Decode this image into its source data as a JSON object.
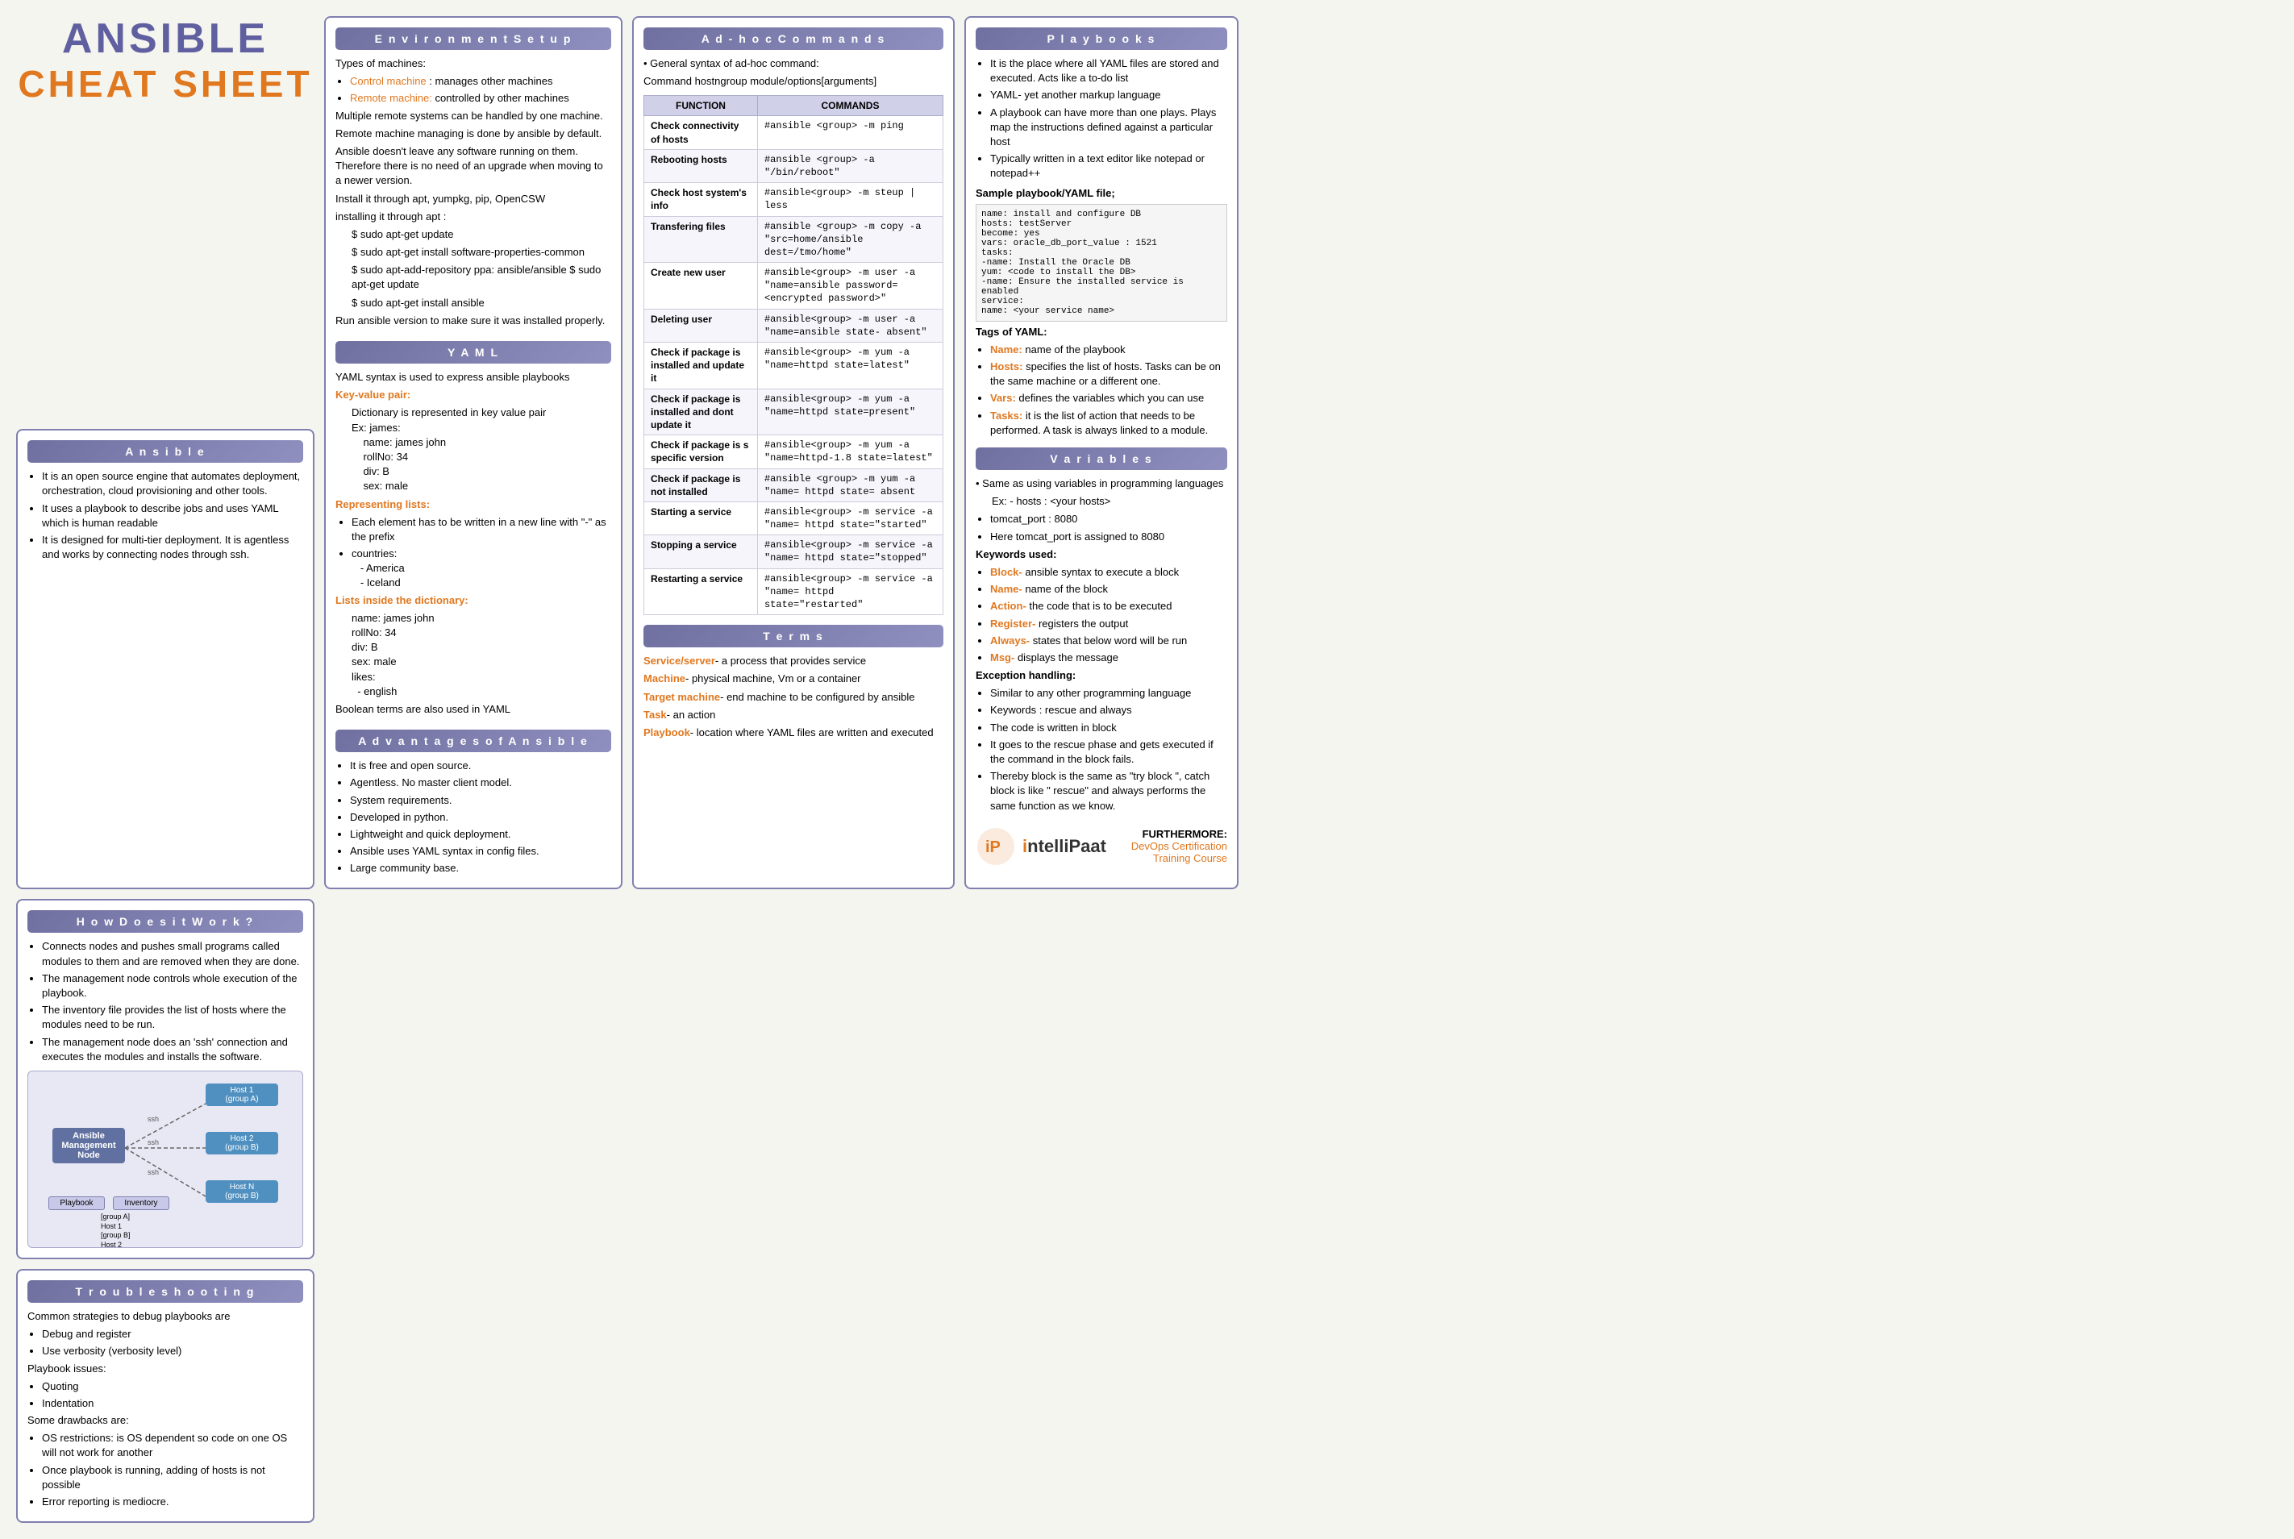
{
  "title": {
    "line1": "ANSIBLE",
    "line2": "CHEAT SHEET"
  },
  "ansible_section": {
    "title": "A n s i b l e",
    "points": [
      "It is an open source engine that automates deployment, orchestration, cloud provisioning and other tools.",
      "It uses a playbook to describe jobs and uses YAML which is human readable",
      "It is designed for multi-tier deployment. It is agentless and works by connecting nodes through ssh."
    ]
  },
  "how_it_works": {
    "title": "H o w   D o e s   i t   W o r k ?",
    "points": [
      "Connects nodes and pushes small programs called modules to them and are removed when they are done.",
      "The management node controls whole execution of the playbook.",
      "The inventory file provides the list of hosts where the modules need to be run.",
      "The management node does an 'ssh' connection and   executes the modules and installs the software."
    ]
  },
  "troubleshooting": {
    "title": "T r o u b l e s h o o t i n g",
    "debug_header": "Common strategies to debug playbooks are",
    "debug_items": [
      "Debug and register",
      "Use verbosity (verbosity level)"
    ],
    "playbook_issues_header": "Playbook issues:",
    "playbook_issues": [
      "Quoting",
      "Indentation"
    ],
    "drawbacks_header": "Some drawbacks are:",
    "drawbacks": [
      "OS restrictions: is OS dependent so code on one OS will not work for another",
      "Once playbook is running, adding of hosts is not possible",
      "Error reporting is mediocre."
    ]
  },
  "environment_setup": {
    "title": "E n v i r o n m e n t   S e t u p",
    "types_header": "Types of machines:",
    "control_machine": "Control machine : manages other machines",
    "remote_machine": "Remote machine: controlled by other machines",
    "points": [
      "Multiple remote systems can be handled by one machine.",
      "Remote machine managing is done by ansible by default.",
      "Ansible doesn't leave any software running on them. Therefore there is no need of an upgrade when moving to a newer version.",
      "Install it through apt, yumpkg, pip, OpenCSW",
      "Installing it through apt :",
      "$ sudo apt-get update",
      "$ sudo apt-get install software-properties-common",
      "$ sudo apt-add-repository ppa: ansible/ansible $ sudo apt-get update",
      "$ sudo apt-get install ansible",
      "Run ansible version to make sure it was installed properly."
    ]
  },
  "yaml": {
    "title": "Y A M L",
    "intro": "YAML syntax is used to express ansible playbooks",
    "key_value_header": "Key-value pair:",
    "key_value_body": "Dictionary is represented in key value pair\nEx: james:\n    name: james john\n    rollNo: 34\n    div: B\n    sex: male",
    "representing_lists_header": "Representing lists:",
    "representing_lists_body": "Each element has to be written in a new line with \"-\" as the prefix\ncountries:\n  - America\n  - Iceland",
    "lists_in_dict_header": "Lists inside the dictionary:",
    "lists_in_dict_body": "name: james john\nrollNo: 34\ndiv: B\nsex: male\nlikes:\n  - english",
    "boolean": "Boolean terms are also used in YAML"
  },
  "advantages": {
    "title": "A d v a n t a g e s   o f   A n s i b l e",
    "points": [
      "It is free and open source.",
      "Agentless. No master client model.",
      "System requirements.",
      "Developed in python.",
      "Lightweight and quick deployment.",
      "Ansible uses YAML syntax in config files.",
      "Large community base."
    ]
  },
  "adhoc": {
    "title": "A d - h o c   C o m m a n d s",
    "intro": "General syntax of ad-hoc command:",
    "syntax": "Command hostngroup module/options[arguments]",
    "table_headers": [
      "FUNCTION",
      "COMMANDS"
    ],
    "table_rows": [
      [
        "Check connectivity of hosts",
        "#ansible <group> -m ping"
      ],
      [
        "Rebooting hosts",
        "#ansible <group> -a \"/bin/reboot\""
      ],
      [
        "Check host system's info",
        "#ansible<group> -m steup | less"
      ],
      [
        "Transfering files",
        "#ansible <group> -m copy -a \"src=home/ansible dest=/tmo/home\""
      ],
      [
        "Create new user",
        "#ansible<group> -m user -a \"name=ansible password= <encrypted password>\""
      ],
      [
        "Deleting user",
        "#ansible<group> -m user -a \"name=ansible state- absent\""
      ],
      [
        "Check if package is installed and update it",
        "#ansible<group> -m yum -a \"name=httpd state=latest\""
      ],
      [
        "Check if package is installed and dont update it",
        "#ansible<group> -m yum -a \"name=httpd state=present\""
      ],
      [
        "Check if package is s specific version",
        "#ansible<group> -m yum -a \"name=httpd-1.8 state=latest\""
      ],
      [
        "Check if package is not installed",
        "#ansible <group> -m yum -a \"name= httpd state= absent"
      ],
      [
        "Starting a service",
        "#ansible<group> -m service -a \"name= httpd state=\"started\""
      ],
      [
        "Stopping a service",
        "#ansible<group> -m service -a \"name= httpd state=\"stopped\""
      ],
      [
        "Restarting a service",
        "#ansible<group> -m service -a \"name= httpd state=\"restarted\""
      ]
    ]
  },
  "terms": {
    "title": "T e r m s",
    "items": [
      {
        "label": "Service/server",
        "rest": "- a process that provides service"
      },
      {
        "label": "Machine",
        "rest": "- physical machine, Vm or a container"
      },
      {
        "label": "Target machine",
        "rest": "- end machine to be configured by ansible"
      },
      {
        "label": "Task",
        "rest": "- an action"
      },
      {
        "label": "Playbook",
        "rest": "- location where YAML files are written and executed"
      }
    ]
  },
  "playbooks": {
    "title": "P l a y b o o k s",
    "points": [
      "It is the place where all YAML files are stored and executed. Acts like a to-do list",
      "YAML- yet another markup language",
      "A playbook can have more than one plays. Plays map the instructions defined against a particular host",
      "Typically written in a text editor like notepad or notepad++"
    ],
    "sample_header": "Sample playbook/YAML file;",
    "sample_code": "name: install and configure DB\nhosts: testServer\nbecome: yes\nvars: oracle_db_port_value : 1521\ntasks:\n  -name: Install the Oracle DB\n  yum: <code to install the DB>\n  -name: Ensure the installed service is enabled\n  service:\n    name: <your service name>",
    "tags_header": "Tags of YAML:",
    "tags": [
      {
        "label": "Name:",
        "rest": " name of the playbook"
      },
      {
        "label": "Hosts:",
        "rest": " specifies the list of hosts. Tasks can be on the same machine or a different one."
      },
      {
        "label": "Vars:",
        "rest": " defines the variables which you can use"
      },
      {
        "label": "Tasks:",
        "rest": " it is the list of action that needs to be performed. A task is always linked to a module."
      }
    ]
  },
  "variables": {
    "title": "V a r i a b l e s",
    "intro": "Same as using variables in programming languages",
    "example": "Ex: - hosts : <your hosts>",
    "items": [
      "tomcat_port : 8080",
      "Here tomcat_port is assigned to 8080"
    ],
    "keywords_header": "Keywords used:",
    "keywords": [
      {
        "label": "Block-",
        "rest": " ansible syntax to execute a block"
      },
      {
        "label": "Name-",
        "rest": " name of the block"
      },
      {
        "label": "Action-",
        "rest": " the code that is to be executed"
      },
      {
        "label": "Register-",
        "rest": " registers the output"
      },
      {
        "label": "Always-",
        "rest": " states that below word will be run"
      },
      {
        "label": "Msg-",
        "rest": " displays the message"
      }
    ],
    "exception_header": "Exception handling:",
    "exception_points": [
      "Similar to any other programming language",
      "Keywords : rescue and always",
      "The code is written in block",
      "It goes to the rescue phase and gets executed if the command in the block fails.",
      "Thereby block is the same as \"try block \", catch block is like \" rescue\" and always performs the same function as we know."
    ]
  },
  "footer": {
    "logo_text": "ntelliPaat",
    "furthermore_label": "FURTHERMORE:",
    "furthermore_link": "DevOps Certification Training Course"
  }
}
